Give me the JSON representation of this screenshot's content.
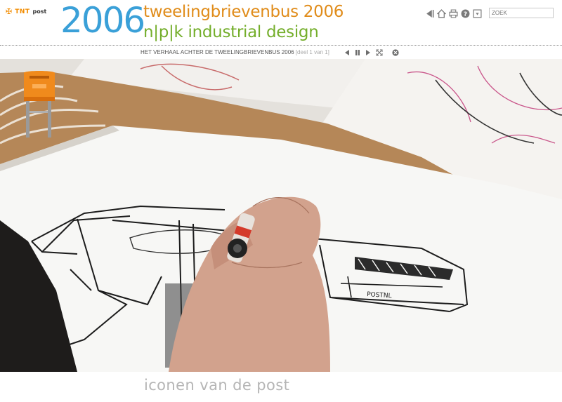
{
  "logo": {
    "brand": "TNT",
    "suffix": "post"
  },
  "header": {
    "year": "2006",
    "title": "tweelingbrievenbus 2006",
    "subtitle": "n|p|k industrial design"
  },
  "toolbar": {
    "icons": [
      "back-icon",
      "home-icon",
      "print-icon",
      "help-icon",
      "download-icon"
    ],
    "search_placeholder": "ZOEK"
  },
  "video": {
    "title": "HET VERHAAL ACHTER DE TWEELINGBRIEVENBUS 2006",
    "part": "[deel 1 van 1]",
    "controls": [
      "previous-icon",
      "pause-icon",
      "next-icon",
      "fullscreen-icon",
      "close-icon"
    ],
    "sketch_text": "POSTNL"
  },
  "footer": {
    "caption": "iconen van de post"
  },
  "colors": {
    "year_blue": "#3aa0d8",
    "title_orange": "#e08c1a",
    "subtitle_green": "#74ae2b",
    "tnt_orange": "#f28c00",
    "footer_grey": "#b5b5b5"
  }
}
